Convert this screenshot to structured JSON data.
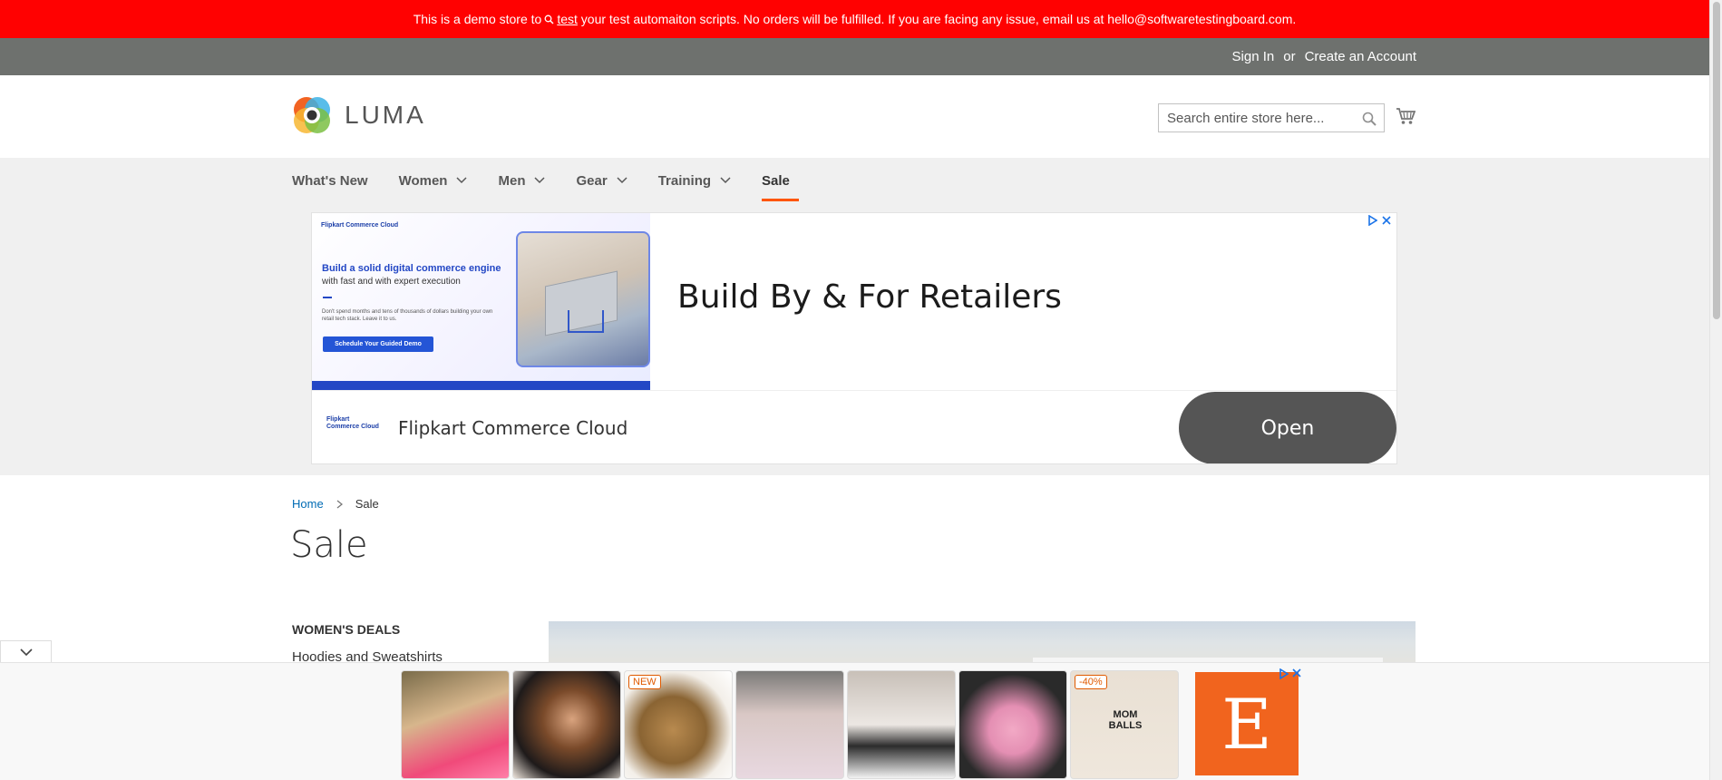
{
  "demo_banner": {
    "text_before": "This is a demo store to",
    "link": "test",
    "text_after": "your test automaiton scripts. No orders will be fulfilled. If you are facing any issue, email us at hello@softwaretestingboard.com."
  },
  "topbar": {
    "sign_in": "Sign In",
    "or": "or",
    "create_account": "Create an Account"
  },
  "header": {
    "logo_text": "LUMA",
    "search_placeholder": "Search entire store here..."
  },
  "nav": {
    "items": [
      {
        "label": "What's New",
        "has_dropdown": false
      },
      {
        "label": "Women",
        "has_dropdown": true
      },
      {
        "label": "Men",
        "has_dropdown": true
      },
      {
        "label": "Gear",
        "has_dropdown": true
      },
      {
        "label": "Training",
        "has_dropdown": true
      },
      {
        "label": "Sale",
        "has_dropdown": false,
        "active": true
      }
    ]
  },
  "ad": {
    "creative_brand": "Flipkart Commerce Cloud",
    "creative_headline": "Build a solid digital commerce engine",
    "creative_sub": "with fast and with expert execution",
    "creative_small": "Don't spend months and tens of thousands of dollars building your own retail tech stack. Leave it to us.",
    "creative_cta": "Schedule Your Guided Demo",
    "headline": "Build By & For Retailers",
    "brand": "Flipkart Commerce Cloud",
    "open_button": "Open"
  },
  "breadcrumb": {
    "home": "Home",
    "current": "Sale"
  },
  "page_title": "Sale",
  "sidebar": {
    "title": "WOMEN'S DEALS",
    "first_link": "Hoodies and Sweatshirts"
  },
  "bottom_ad": {
    "badges": [
      "NEW",
      "-40%"
    ],
    "thumb7_text": "MOM BALLS",
    "etsy_letter": "E"
  },
  "colors": {
    "banner": "#ff0101",
    "topbar": "#6e716e",
    "accent": "#ff5501",
    "link": "#006bb4",
    "etsy": "#f1641e"
  }
}
